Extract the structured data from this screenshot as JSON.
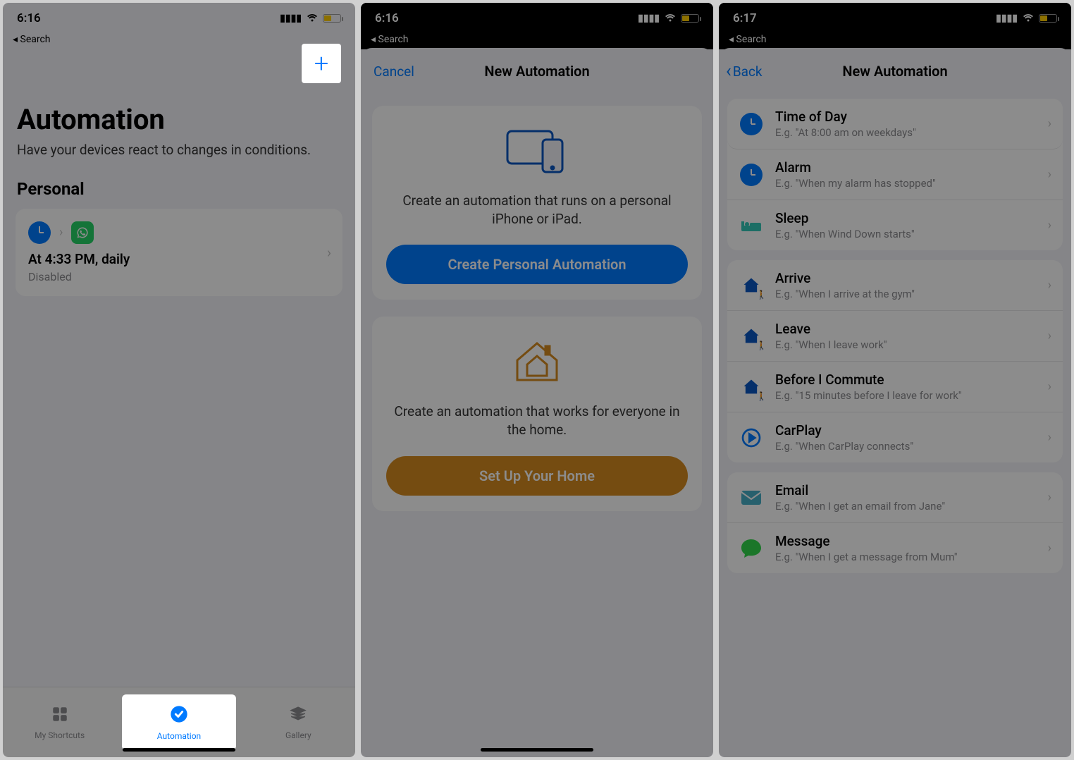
{
  "screen1": {
    "time": "6:16",
    "back": "◂ Search",
    "title": "Automation",
    "subtitle": "Have your devices react to changes in conditions.",
    "section": "Personal",
    "card": {
      "title": "At 4:33 PM, daily",
      "sub": "Disabled"
    },
    "tabs": {
      "shortcuts": "My Shortcuts",
      "automation": "Automation",
      "gallery": "Gallery"
    }
  },
  "screen2": {
    "time": "6:16",
    "back": "◂ Search",
    "cancel": "Cancel",
    "title": "New Automation",
    "personal": {
      "desc": "Create an automation that runs on a personal iPhone or iPad.",
      "button": "Create Personal Automation"
    },
    "home": {
      "desc": "Create an automation that works for everyone in the home.",
      "button": "Set Up Your Home"
    }
  },
  "screen3": {
    "time": "6:17",
    "back": "◂ Search",
    "navback": "Back",
    "title": "New Automation",
    "group1": [
      {
        "title": "Time of Day",
        "sub": "E.g. \"At 8:00 am on weekdays\""
      },
      {
        "title": "Alarm",
        "sub": "E.g. \"When my alarm has stopped\""
      },
      {
        "title": "Sleep",
        "sub": "E.g. \"When Wind Down starts\""
      }
    ],
    "group2": [
      {
        "title": "Arrive",
        "sub": "E.g. \"When I arrive at the gym\""
      },
      {
        "title": "Leave",
        "sub": "E.g. \"When I leave work\""
      },
      {
        "title": "Before I Commute",
        "sub": "E.g. \"15 minutes before I leave for work\""
      },
      {
        "title": "CarPlay",
        "sub": "E.g. \"When CarPlay connects\""
      }
    ],
    "group3": [
      {
        "title": "Email",
        "sub": "E.g. \"When I get an email from Jane\""
      },
      {
        "title": "Message",
        "sub": "E.g. \"When I get a message from Mum\""
      }
    ]
  }
}
